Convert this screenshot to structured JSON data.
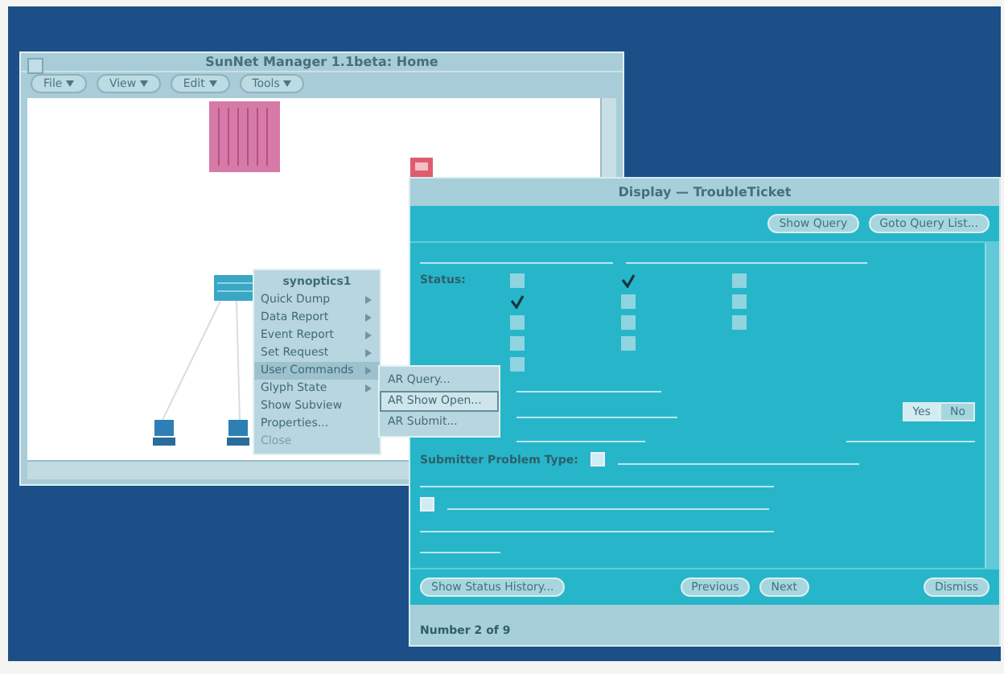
{
  "manager": {
    "title": "SunNet Manager 1.1beta: Home",
    "menus": [
      "File",
      "View",
      "Edit",
      "Tools"
    ]
  },
  "context_menu": {
    "title": "synoptics1",
    "items": [
      {
        "label": "Quick Dump",
        "submenu": true,
        "disabled": false,
        "selected": false
      },
      {
        "label": "Data Report",
        "submenu": true,
        "disabled": false,
        "selected": false
      },
      {
        "label": "Event Report",
        "submenu": true,
        "disabled": false,
        "selected": false
      },
      {
        "label": "Set Request",
        "submenu": true,
        "disabled": false,
        "selected": false
      },
      {
        "label": "User Commands",
        "submenu": true,
        "disabled": false,
        "selected": true
      },
      {
        "label": "Glyph State",
        "submenu": true,
        "disabled": false,
        "selected": false
      },
      {
        "label": "Show Subview",
        "submenu": false,
        "disabled": false,
        "selected": false
      },
      {
        "label": "Properties...",
        "submenu": false,
        "disabled": false,
        "selected": false
      },
      {
        "label": "Close",
        "submenu": false,
        "disabled": true,
        "selected": false
      }
    ]
  },
  "submenu": {
    "items": [
      {
        "label": "AR Query...",
        "selected": false
      },
      {
        "label": "AR Show Open...",
        "selected": true
      },
      {
        "label": "AR Submit...",
        "selected": false
      }
    ]
  },
  "dialog": {
    "title": "Display — TroubleTicket",
    "top_buttons": [
      "Show Query",
      "Goto Query List..."
    ],
    "status_label": "Status:",
    "checkbox_columns": [
      [
        {
          "checked": false
        },
        {
          "checked": true
        },
        {
          "checked": false
        },
        {
          "checked": false
        },
        {
          "checked": false
        }
      ],
      [
        {
          "checked": true
        },
        {
          "checked": false
        },
        {
          "checked": false
        },
        {
          "checked": false
        }
      ],
      [
        {
          "checked": false
        },
        {
          "checked": false
        },
        {
          "checked": false
        }
      ]
    ],
    "choice": [
      {
        "label": "Yes",
        "selected": true
      },
      {
        "label": "No",
        "selected": false
      }
    ],
    "problem_type_label": "Submitter Problem Type:",
    "bottom_left": "Show Status History...",
    "bottom_middle": [
      "Previous",
      "Next"
    ],
    "bottom_right": "Dismiss",
    "footer": "Number 2 of 9"
  }
}
